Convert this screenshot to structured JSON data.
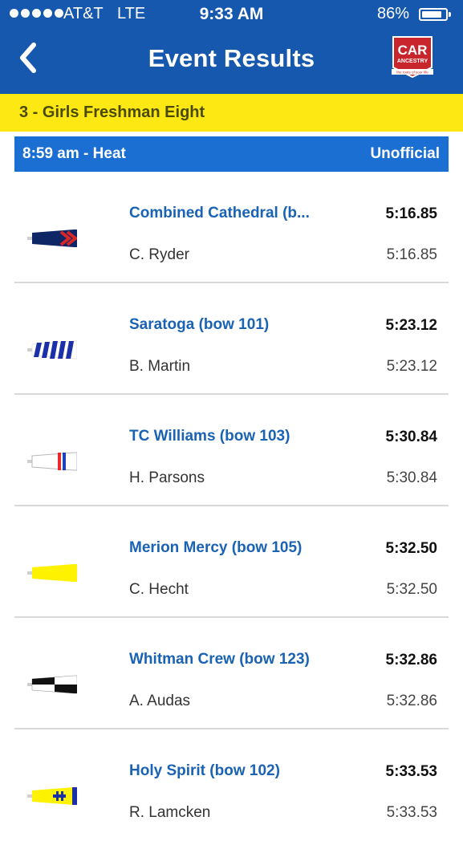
{
  "status_bar": {
    "carrier": "AT&T",
    "network": "LTE",
    "time": "9:33 AM",
    "battery": "86%",
    "battery_level": 0.86
  },
  "nav": {
    "title": "Event Results",
    "back_icon": "chevron-left-icon",
    "logo_text_main": "CAR",
    "logo_text_sub": "ANCESTRY",
    "logo_tagline": "the roots of your life"
  },
  "event": {
    "name": "3 - Girls Freshman Eight"
  },
  "heat": {
    "title": "8:59 am - Heat",
    "status": "Unofficial"
  },
  "colors": {
    "header_bg": "#1658ad",
    "event_bar_bg": "#fde814",
    "heat_bar_bg": "#1b6fd3",
    "crew_name": "#1a62b3"
  },
  "results": [
    {
      "crew": "Combined Cathedral (b...",
      "coxswain": "C. Ryder",
      "time": "5:16.85",
      "time_secondary": "5:16.85",
      "oar_icon": "oar-navy-red-chevrons-icon"
    },
    {
      "crew": "Saratoga (bow 101)",
      "coxswain": "B. Martin",
      "time": "5:23.12",
      "time_secondary": "5:23.12",
      "oar_icon": "oar-blue-white-stripes-icon"
    },
    {
      "crew": "TC Williams (bow 103)",
      "coxswain": "H. Parsons",
      "time": "5:30.84",
      "time_secondary": "5:30.84",
      "oar_icon": "oar-white-red-blue-bands-icon"
    },
    {
      "crew": "Merion Mercy (bow 105)",
      "coxswain": "C. Hecht",
      "time": "5:32.50",
      "time_secondary": "5:32.50",
      "oar_icon": "oar-yellow-icon"
    },
    {
      "crew": "Whitman Crew (bow 123)",
      "coxswain": "A. Audas",
      "time": "5:32.86",
      "time_secondary": "5:32.86",
      "oar_icon": "oar-black-white-checker-icon"
    },
    {
      "crew": "Holy Spirit (bow 102)",
      "coxswain": "R. Lamcken",
      "time": "5:33.53",
      "time_secondary": "5:33.53",
      "oar_icon": "oar-yellow-blue-cross-icon"
    }
  ]
}
